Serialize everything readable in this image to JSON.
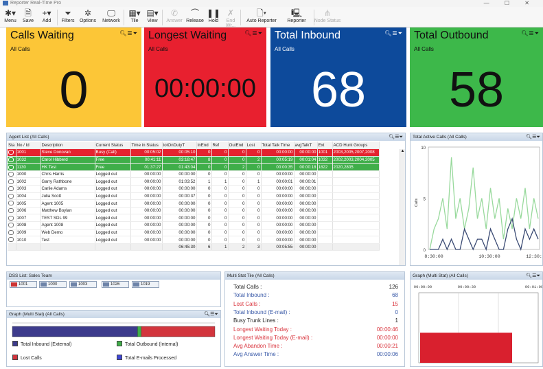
{
  "window": {
    "title": "Reporter Real-Time Pro",
    "controls": "—  ☐  ✕"
  },
  "toolbar": [
    {
      "id": "menu",
      "label": "Menu",
      "icon": "gear-icon",
      "glyph": "✱▾",
      "enabled": true
    },
    {
      "id": "save",
      "label": "Save",
      "icon": "save-icon",
      "glyph": "🗎",
      "enabled": true
    },
    {
      "id": "add",
      "label": "Add",
      "icon": "add-icon",
      "glyph": "+▾",
      "enabled": true
    },
    {
      "id": "filters",
      "label": "Filters",
      "icon": "filter-icon",
      "glyph": "⏷",
      "enabled": true
    },
    {
      "id": "options",
      "label": "Options",
      "icon": "gear-icon",
      "glyph": "✲",
      "enabled": true
    },
    {
      "id": "network",
      "label": "Network",
      "icon": "network-icon",
      "glyph": "🖵",
      "enabled": true
    },
    {
      "id": "tile",
      "label": "Tile",
      "icon": "tile-icon",
      "glyph": "▦▾",
      "enabled": true
    },
    {
      "id": "view",
      "label": "View",
      "icon": "view-icon",
      "glyph": "▤▾",
      "enabled": true
    },
    {
      "id": "answer",
      "label": "Answer",
      "icon": "phone-icon",
      "glyph": "✆",
      "enabled": false
    },
    {
      "id": "release",
      "label": "Release",
      "icon": "release-icon",
      "glyph": "⌒",
      "enabled": true
    },
    {
      "id": "hold",
      "label": "Hold",
      "icon": "pause-icon",
      "glyph": "❚❚",
      "enabled": true
    },
    {
      "id": "endwrapup",
      "label": "End Wr...",
      "icon": "end-wrap-icon",
      "glyph": "✗",
      "enabled": false
    },
    {
      "id": "autoreporter",
      "label": "Auto Reporter",
      "icon": "document-icon",
      "glyph": "🗋▾",
      "enabled": true
    },
    {
      "id": "reporter",
      "label": "Reporter",
      "icon": "reporter-icon",
      "glyph": "🖳",
      "enabled": true
    },
    {
      "id": "nodestatus",
      "label": "Node Status",
      "icon": "node-icon",
      "glyph": "⋔",
      "enabled": false
    }
  ],
  "tiles": [
    {
      "name": "Calls Waiting",
      "sub": "All Calls",
      "value": "0",
      "bg": "#fcc637"
    },
    {
      "name": "Longest Waiting",
      "sub": "All Calls",
      "value": "00:00:00",
      "bg": "#e8202f"
    },
    {
      "name": "Total Inbound",
      "sub": "All Calls",
      "value": "68",
      "bg": "#0d4a9b"
    },
    {
      "name": "Total Outbound",
      "sub": "All Calls",
      "value": "58",
      "bg": "#3db84a"
    }
  ],
  "tile_icons": "🔍︎☰⏷",
  "agent_list": {
    "title": "Agent List (All Calls)",
    "columns": [
      "Sta",
      "No / Id",
      "Description",
      "Current Status",
      "Time in Status",
      "totOnDutyT",
      "InEnd",
      "Ref",
      "OutEnd",
      "Lost",
      "Total Talk Time",
      "avgTalkT",
      "Ext",
      "ACD Hunt Groups"
    ],
    "rows": [
      {
        "state": "busy",
        "cells": [
          "",
          "1001",
          "Steve Donovan",
          "Busy (Call)",
          "00:05:02",
          "00:05:10",
          "0",
          "0",
          "0",
          "0",
          "00:00:00",
          "00:00:00",
          "1001",
          "2003,2005,2007,2008"
        ]
      },
      {
        "state": "free",
        "cells": [
          "",
          "1032",
          "Carol Hibberd",
          "Free",
          "00:41:11",
          "03:18:47",
          "8",
          "0",
          "0",
          "2",
          "00:05:19",
          "00:01:04",
          "1032",
          "2002,2003,2004,2005"
        ]
      },
      {
        "state": "free",
        "cells": [
          "",
          "1130",
          "HK Test",
          "Free",
          "01:37:27",
          "01:43:04",
          "0",
          "0",
          "2",
          "0",
          "00:00:35",
          "00:00:18",
          "1822",
          "2020,2805"
        ]
      },
      {
        "state": "out",
        "cells": [
          "",
          "1000",
          "Chris Harris",
          "Logged out",
          "00:00:00",
          "00:00:00",
          "0",
          "0",
          "0",
          "0",
          "00:00:00",
          "00:00:00",
          "",
          ""
        ]
      },
      {
        "state": "out",
        "cells": [
          "",
          "1002",
          "Garry Rathbone",
          "Logged out",
          "00:00:00",
          "01:03:52",
          "1",
          "1",
          "0",
          "1",
          "00:00:01",
          "00:00:01",
          "",
          ""
        ]
      },
      {
        "state": "out",
        "cells": [
          "",
          "1003",
          "Carlie Adams",
          "Logged out",
          "00:00:00",
          "00:00:00",
          "0",
          "0",
          "0",
          "0",
          "00:00:00",
          "00:00:00",
          "",
          ""
        ]
      },
      {
        "state": "out",
        "cells": [
          "",
          "1004",
          "Julia Scott",
          "Logged out",
          "00:00:00",
          "00:00:37",
          "0",
          "0",
          "0",
          "0",
          "00:00:00",
          "00:00:00",
          "",
          ""
        ]
      },
      {
        "state": "out",
        "cells": [
          "",
          "1005",
          "Agent 1005",
          "Logged out",
          "00:00:00",
          "00:00:00",
          "0",
          "0",
          "0",
          "0",
          "00:00:00",
          "00:00:00",
          "",
          ""
        ]
      },
      {
        "state": "out",
        "cells": [
          "",
          "1006",
          "Matthew Boylan",
          "Logged out",
          "00:00:00",
          "00:00:00",
          "0",
          "0",
          "0",
          "0",
          "00:00:00",
          "00:00:00",
          "",
          ""
        ]
      },
      {
        "state": "out",
        "cells": [
          "",
          "1007",
          "TEST SDL 99",
          "Logged out",
          "00:00:00",
          "00:00:00",
          "0",
          "0",
          "0",
          "0",
          "00:00:00",
          "00:00:00",
          "",
          ""
        ]
      },
      {
        "state": "out",
        "cells": [
          "",
          "1008",
          "Agent 1008",
          "Logged out",
          "00:00:00",
          "00:00:00",
          "0",
          "0",
          "0",
          "0",
          "00:00:00",
          "00:00:00",
          "",
          ""
        ]
      },
      {
        "state": "out",
        "cells": [
          "",
          "1009",
          "Web Demo",
          "Logged out",
          "00:00:00",
          "00:00:00",
          "0",
          "0",
          "0",
          "0",
          "00:00:00",
          "00:00:00",
          "",
          ""
        ]
      },
      {
        "state": "out",
        "cells": [
          "",
          "1010",
          "Test",
          "Logged out",
          "00:00:00",
          "00:00:00",
          "0",
          "0",
          "0",
          "0",
          "00:00:00",
          "00:00:00",
          "",
          ""
        ]
      },
      {
        "state": "tot",
        "cells": [
          "",
          "",
          "",
          "",
          "",
          "06:45:30",
          "6",
          "1",
          "2",
          "3",
          "00:05:55",
          "00:00:00",
          "",
          ""
        ]
      }
    ]
  },
  "active_calls": {
    "title": "Total Active Calls (All Calls)",
    "ylabel": "Calls",
    "xticks": [
      "8:30:00",
      "10:30:00",
      "12:30:0"
    ]
  },
  "dss": {
    "title": "DSS List: Sales Team",
    "items": [
      "1001",
      "1000",
      "1003",
      "1026",
      "1019"
    ]
  },
  "graph_bottom_left": {
    "title": "Graph (Multi Stat) (All Calls)",
    "legend": [
      {
        "label": "Total Inbound (External)",
        "color": "#3d3b8c"
      },
      {
        "label": "Total Outbound (Internal)",
        "color": "#3fae49"
      },
      {
        "label": "Lost Calls",
        "color": "#d2353d"
      },
      {
        "label": "Total E-mails Processed",
        "color": "#3f47d6"
      }
    ]
  },
  "multistat": {
    "title": "Multi Stat Tile (All Calls)",
    "rows": [
      {
        "label": "Total Calls :",
        "value": "126",
        "color": "#222222"
      },
      {
        "label": "Total Inbound :",
        "value": "68",
        "color": "#3a5aa8"
      },
      {
        "label": "Lost Calls :",
        "value": "15",
        "color": "#d9333c"
      },
      {
        "label": "Total Inbound (E-mail) :",
        "value": "0",
        "color": "#3a5aa8"
      },
      {
        "label": "Busy Trunk Lines :",
        "value": "1",
        "color": "#222222"
      },
      {
        "label": "Longest Waiting Today :",
        "value": "00:00:46",
        "color": "#d9333c"
      },
      {
        "label": "Longest Waiting Today (E-mail) :",
        "value": "00:00:00",
        "color": "#d9333c"
      },
      {
        "label": "Avg Abandon Time :",
        "value": "00:00:21",
        "color": "#d9333c"
      },
      {
        "label": "Avg Answer Time :",
        "value": "00:00:06",
        "color": "#3a5aa8"
      }
    ]
  },
  "graph_bottom_right": {
    "title": "Graph (Multi Stat) (All Calls)",
    "xticks": [
      "00:00:00",
      "00:00:30",
      "00:01:00"
    ]
  },
  "chart_data": [
    {
      "type": "line",
      "title": "Total Active Calls (All Calls)",
      "ylabel": "Calls",
      "ylim": [
        0,
        10
      ],
      "yticks": [
        0,
        5,
        10
      ],
      "x": [
        0,
        1,
        2,
        3,
        4,
        5,
        6,
        7,
        8,
        9,
        10,
        11,
        12,
        13,
        14,
        15,
        16,
        17,
        18,
        19,
        20,
        21,
        22,
        23,
        24,
        25
      ],
      "series": [
        {
          "color": "#98d99c",
          "values": [
            0,
            2,
            3,
            5,
            2,
            9,
            3,
            5,
            2,
            4,
            8,
            3,
            5,
            2,
            6,
            3,
            5,
            1,
            4,
            2,
            5,
            3,
            6,
            2,
            5,
            3
          ]
        },
        {
          "color": "#3a4a73",
          "values": [
            0,
            0,
            0,
            1,
            0,
            1,
            0,
            0,
            2,
            1,
            0,
            1,
            1,
            0,
            2,
            1,
            0,
            0,
            2,
            3,
            1,
            0,
            2,
            1,
            2,
            1
          ]
        }
      ]
    },
    {
      "type": "bar",
      "title": "Graph (Multi Stat) (All Calls)",
      "orientation": "horizontal-stacked",
      "series": [
        {
          "name": "Total Inbound (External)",
          "value": 68,
          "color": "#3d3b8c"
        },
        {
          "name": "Total Outbound (Internal)",
          "value": 2,
          "color": "#3fae49"
        },
        {
          "name": "Lost Calls",
          "value": 40,
          "color": "#d2353d"
        }
      ]
    },
    {
      "type": "bar",
      "title": "Graph (Multi Stat) (All Calls)",
      "ylim": [
        0,
        1
      ],
      "values": [
        0.43
      ],
      "color": "#d9202e"
    }
  ]
}
